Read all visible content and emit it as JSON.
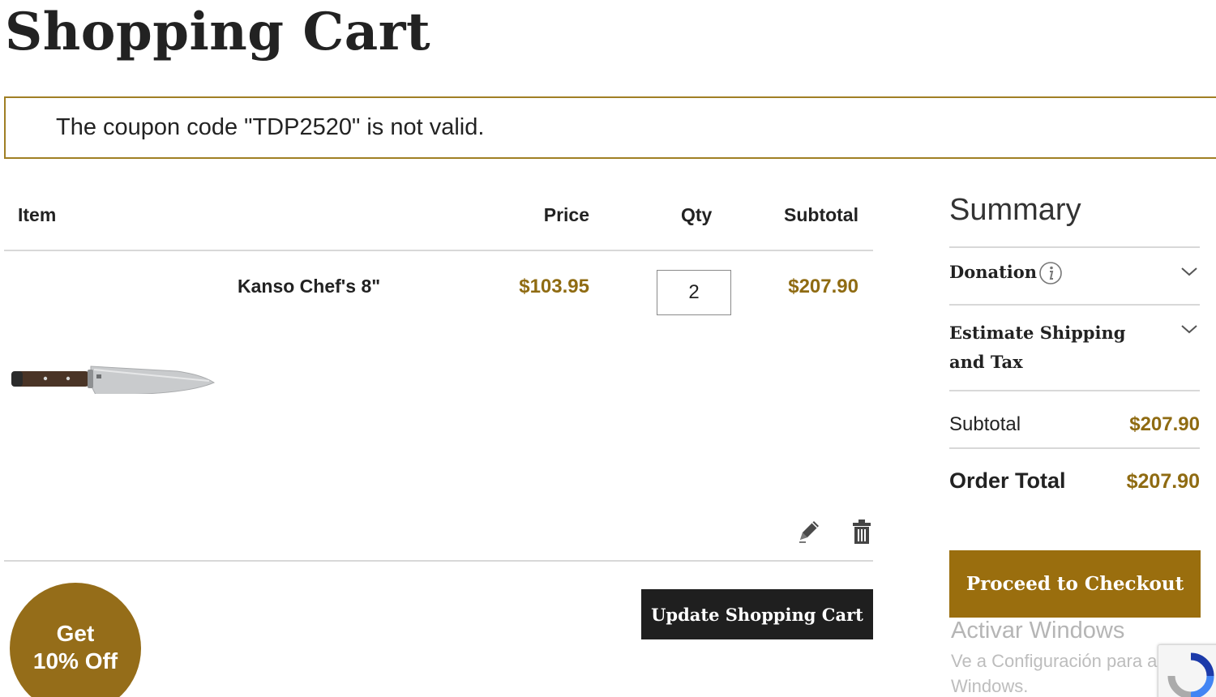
{
  "page": {
    "title": "Shopping Cart"
  },
  "alert": {
    "message": "The coupon code \"TDP2520\" is not valid."
  },
  "cart": {
    "headers": {
      "item": "Item",
      "price": "Price",
      "qty": "Qty",
      "subtotal": "Subtotal"
    },
    "items": [
      {
        "name": "Kanso Chef's 8\"",
        "price": "$103.95",
        "qty": "2",
        "subtotal": "$207.90"
      }
    ],
    "update_label": "Update Shopping Cart"
  },
  "summary": {
    "title": "Summary",
    "donation_label": "Donation",
    "shipping_label": "Estimate Shipping and Tax",
    "subtotal_label": "Subtotal",
    "subtotal_value": "$207.90",
    "total_label": "Order Total",
    "total_value": "$207.90",
    "checkout_label": "Proceed to Checkout"
  },
  "promo": {
    "line1": "Get",
    "line2": "10% Off"
  },
  "windows_watermark": {
    "title": "Activar Windows",
    "subtitle": "Ve a Configuración para activar Windows."
  },
  "colors": {
    "accent": "#9a6e0e",
    "price": "#8f6b12",
    "alert_border": "#a07f24",
    "dark_button": "#1f1f1f"
  },
  "icons": {
    "edit": "pencil-icon",
    "delete": "trash-icon",
    "info": "info-icon",
    "expand": "chevron-down-icon"
  }
}
